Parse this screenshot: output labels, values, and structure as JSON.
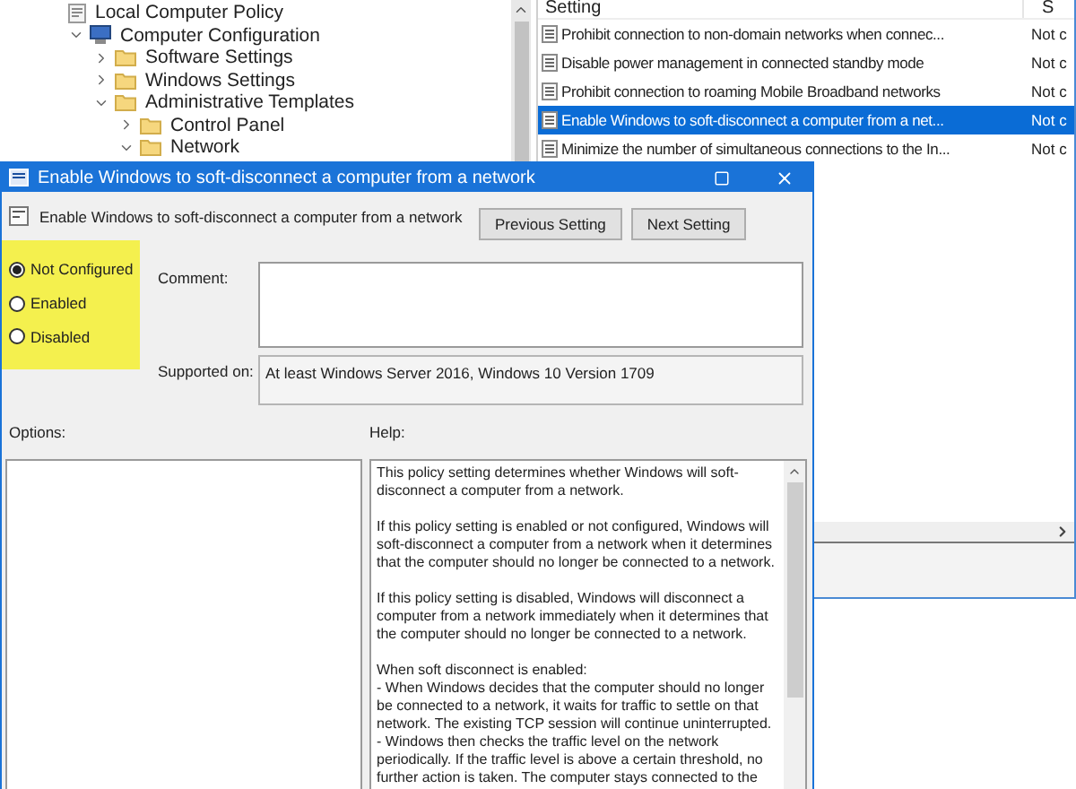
{
  "tree": {
    "items": [
      {
        "label": "Local Computer Policy",
        "kind": "policy",
        "children": [
          {
            "label": "Computer Configuration",
            "kind": "computer",
            "expanded": true,
            "children": [
              {
                "label": "Software Settings",
                "kind": "folder",
                "expanded": false
              },
              {
                "label": "Windows Settings",
                "kind": "folder",
                "expanded": false
              },
              {
                "label": "Administrative Templates",
                "kind": "folder",
                "expanded": true,
                "children": [
                  {
                    "label": "Control Panel",
                    "kind": "folder",
                    "expanded": false
                  },
                  {
                    "label": "Network",
                    "kind": "folder",
                    "expanded": true
                  }
                ]
              }
            ]
          }
        ]
      }
    ]
  },
  "list": {
    "columns": [
      "Setting",
      "S"
    ],
    "rows": [
      {
        "name": "Prohibit connection to non-domain networks when connec...",
        "state": "Not c",
        "selected": false
      },
      {
        "name": "Disable power management in connected standby mode",
        "state": "Not c",
        "selected": false
      },
      {
        "name": "Prohibit connection to roaming Mobile Broadband networks",
        "state": "Not c",
        "selected": false
      },
      {
        "name": "Enable Windows to soft-disconnect a computer from a net...",
        "state": "Not c",
        "selected": true
      },
      {
        "name": "Minimize the number of simultaneous connections to the In...",
        "state": "Not c",
        "selected": false
      }
    ]
  },
  "dialog": {
    "title": "Enable Windows to soft-disconnect a computer from a network",
    "setting_name": "Enable Windows to soft-disconnect a computer from a network",
    "buttons": [
      "Previous Setting",
      "Next Setting"
    ],
    "options": [
      {
        "label": "Not Configured",
        "selected": true
      },
      {
        "label": "Enabled",
        "selected": false
      },
      {
        "label": "Disabled",
        "selected": false
      }
    ],
    "comment_label": "Comment:",
    "supported_label": "Supported on:",
    "supported_value": "At least Windows Server 2016, Windows 10 Version 1709",
    "options_label": "Options:",
    "help_label": "Help:",
    "help": [
      [
        "This policy setting determines whether Windows will soft-disconnect a computer from a network."
      ],
      [
        "If this policy setting is enabled or not configured, Windows will soft-disconnect a computer from a network when it determines that the computer should no longer be connected to a network."
      ],
      [
        "If this policy setting is disabled, Windows will disconnect a computer from a network immediately when it determines that the computer should no longer be connected to a network."
      ],
      [
        "When soft disconnect is enabled:",
        "- When Windows decides that the computer should no longer be connected to a network, it waits for traffic to settle on that network. The existing TCP session will continue uninterrupted.",
        "- Windows then checks the traffic level on the network periodically. If the traffic level is above a certain threshold, no further action is taken. The computer stays connected to the"
      ]
    ]
  }
}
